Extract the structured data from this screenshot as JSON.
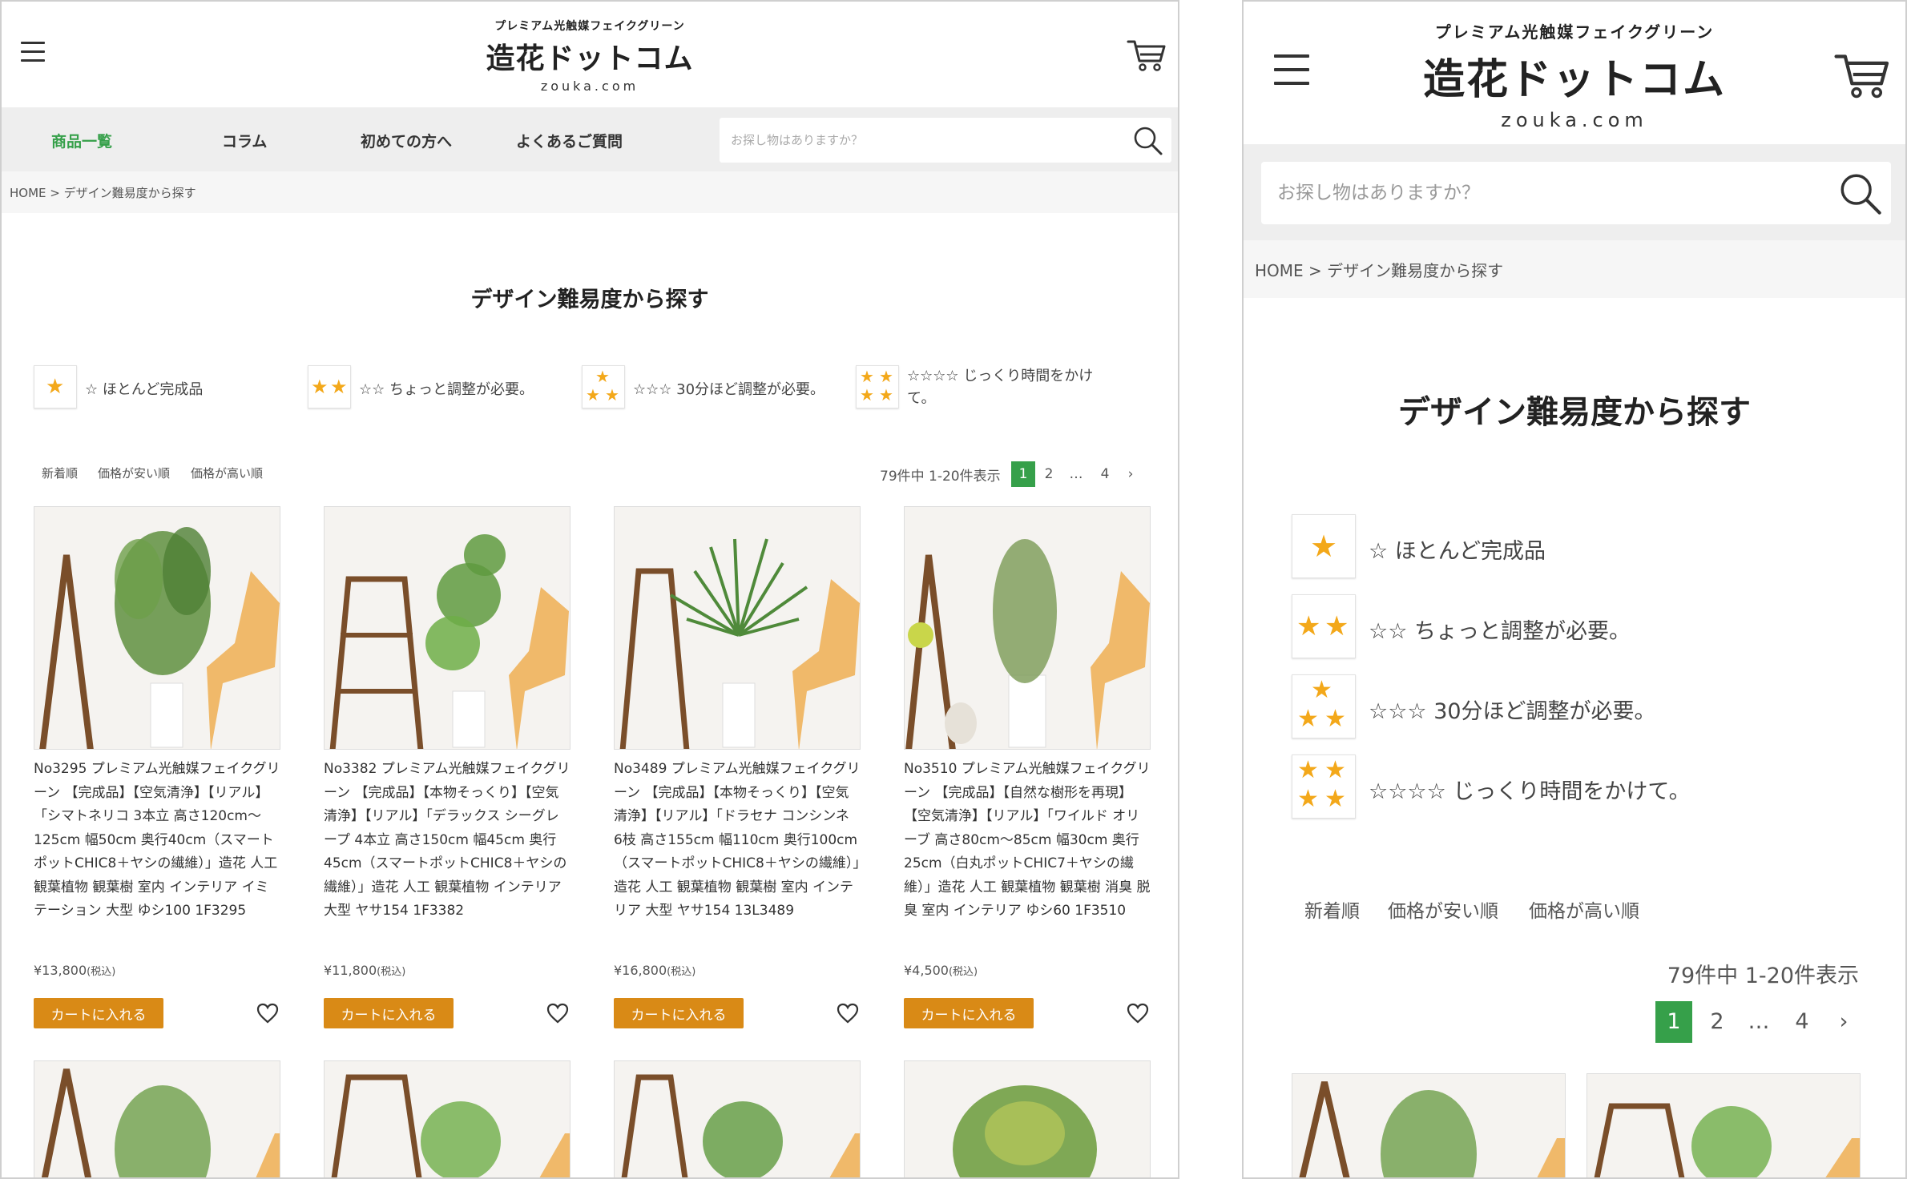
{
  "site": {
    "tagline": "プレミアム光触媒フェイクグリーン",
    "name": "造花ドットコム",
    "url": "zouka.com"
  },
  "nav": {
    "items": [
      "商品一覧",
      "コラム",
      "初めての方へ",
      "よくあるご質問"
    ],
    "active_index": 0
  },
  "search": {
    "placeholder": "お探し物はありますか？"
  },
  "breadcrumb": "HOME > デザイン難易度から探す",
  "page_title": "デザイン難易度から探す",
  "difficulty_legend": [
    {
      "stars": 1,
      "label": "☆ ほとんど完成品"
    },
    {
      "stars": 2,
      "label": "☆☆ ちょっと調整が必要。"
    },
    {
      "stars": 3,
      "label": "☆☆☆ 30分ほど調整が必要。"
    },
    {
      "stars": 4,
      "label": "☆☆☆☆ じっくり時間をかけて。"
    }
  ],
  "sort_options": [
    "新着順",
    "価格が安い順",
    "価格が高い順"
  ],
  "result_count": "79件中 1-20件表示",
  "pagination": [
    "1",
    "2",
    "…",
    "4",
    "›"
  ],
  "pagination_active": "1",
  "products": [
    {
      "description": "No3295 プレミアム光触媒フェイクグリーン 【完成品】【空気清浄】【リアル】「シマトネリコ 3本立 高さ120cm～125cm 幅50cm 奥行40cm（スマートポットCHIC8＋ヤシの繊維）」造花 人工 観葉植物 観葉樹 室内 インテリア イミテーション 大型 ゆシ100 1F3295",
      "price": "¥13,800",
      "tax": "(税込)"
    },
    {
      "description": "No3382 プレミアム光触媒フェイクグリーン 【完成品】【本物そっくり】【空気清浄】【リアル】「デラックス シーグレープ 4本立 高さ150cm 幅45cm 奥行45cm（スマートポットCHIC8＋ヤシの繊維）」造花 人工 観葉植物 インテリア 大型 ヤサ154 1F3382",
      "price": "¥11,800",
      "tax": "(税込)"
    },
    {
      "description": "No3489 プレミアム光触媒フェイクグリーン 【完成品】【本物そっくり】【空気清浄】【リアル】「ドラセナ コンシンネ 6枝 高さ155cm 幅110cm 奥行100cm（スマートポットCHIC8＋ヤシの繊維）」造花 人工 観葉植物 観葉樹 室内 インテリア 大型 ヤサ154 13L3489",
      "price": "¥16,800",
      "tax": "(税込)"
    },
    {
      "description": "No3510 プレミアム光触媒フェイクグリーン 【完成品】【自然な樹形を再現】【空気清浄】【リアル】「ワイルド オリーブ 高さ80cm～85cm 幅30cm 奥行25cm（白丸ポットCHIC7＋ヤシの繊維）」造花 人工 観葉植物 観葉樹 消臭 脱臭 室内 インテリア ゆシ60 1F3510",
      "price": "¥4,500",
      "tax": "(税込)"
    }
  ],
  "add_to_cart_label": "カートに入れる",
  "colors": {
    "accent_green": "#36a04a",
    "cart_button": "#d98a16",
    "star": "#f3a81a",
    "nav_bg": "#eeeeee"
  },
  "icons": [
    "menu-icon",
    "cart-icon",
    "search-icon",
    "star-icon",
    "heart-icon"
  ]
}
